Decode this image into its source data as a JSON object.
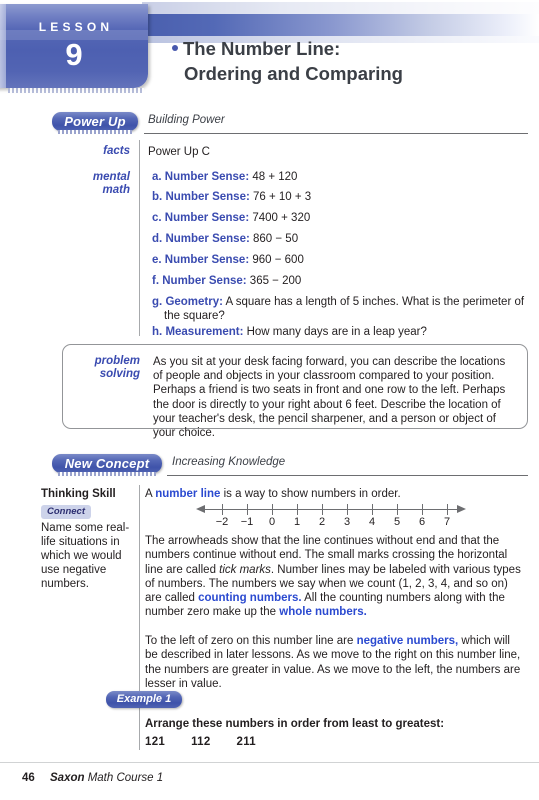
{
  "header": {
    "lesson_word": "LESSON",
    "lesson_number": "9",
    "title_line1": "The Number Line:",
    "title_line2": "Ordering and Comparing",
    "accent_color": "#4758ad"
  },
  "power_up": {
    "pill_label": "Power Up",
    "subtitle": "Building Power",
    "facts_label": "facts",
    "facts_value": "Power Up C",
    "mental_math_label_line1": "mental",
    "mental_math_label_line2": "math",
    "items": [
      {
        "letter": "a.",
        "topic": "Number Sense:",
        "problem": "48 + 120"
      },
      {
        "letter": "b.",
        "topic": "Number Sense:",
        "problem": "76 + 10 + 3"
      },
      {
        "letter": "c.",
        "topic": "Number Sense:",
        "problem": "7400 + 320"
      },
      {
        "letter": "d.",
        "topic": "Number Sense:",
        "problem": "860 − 50"
      },
      {
        "letter": "e.",
        "topic": "Number Sense:",
        "problem": "960 − 600"
      },
      {
        "letter": "f.",
        "topic": "Number Sense:",
        "problem": "365 − 200"
      },
      {
        "letter": "g.",
        "topic": "Geometry:",
        "problem": "A square has a length of 5 inches. What is the perimeter of the square?"
      },
      {
        "letter": "h.",
        "topic": "Measurement:",
        "problem": "How many days are in a leap year?"
      }
    ]
  },
  "problem_solving": {
    "label_line1": "problem",
    "label_line2": "solving",
    "text": "As you sit at your desk facing forward, you can describe the locations of people and objects in your classroom compared to your position. Perhaps a friend is two seats in front and one row to the left. Perhaps the door is directly to your right about 6 feet. Describe the location of your teacher's desk, the pencil sharpener, and a person or object of your choice."
  },
  "new_concept": {
    "pill_label": "New Concept",
    "subtitle": "Increasing Knowledge"
  },
  "thinking_skill": {
    "title": "Thinking Skill",
    "badge": "Connect",
    "text": "Name some real-life situations in which we would use negative numbers."
  },
  "number_line": {
    "ticks": [
      "−2",
      "−1",
      "0",
      "1",
      "2",
      "3",
      "4",
      "5",
      "6",
      "7"
    ],
    "min": -2,
    "max": 7,
    "left_arrow": "arrow-left",
    "right_arrow": "arrow-right"
  },
  "concept": {
    "intro_pre": "A ",
    "intro_kw": "number line",
    "intro_post": " is a way to show numbers in order.",
    "p1_a": "The arrowheads show that the line continues without end and that the numbers continue without end. The small marks crossing the horizontal line are called ",
    "p1_ital": "tick marks",
    "p1_b": ". Number lines may be labeled with various types of numbers. The numbers we say when we count (1, 2, 3, 4, and so on) are called ",
    "p1_kw1": "counting numbers.",
    "p1_c": " All the counting numbers along with the number zero make up the ",
    "p1_kw2": "whole numbers.",
    "p2_a": "To the left of zero on this number line are ",
    "p2_kw": "negative numbers,",
    "p2_b": " which will be described in later lessons. As we move to the right on this number line, the numbers are greater in value. As we move to the left, the numbers are lesser in value."
  },
  "example": {
    "pill_label": "Example 1",
    "prompt": "Arrange these numbers in order from least to greatest:",
    "numbers": [
      "121",
      "112",
      "211"
    ]
  },
  "footer": {
    "page_number": "46",
    "book_bold": "Saxon",
    "book_rest": " Math Course 1"
  }
}
